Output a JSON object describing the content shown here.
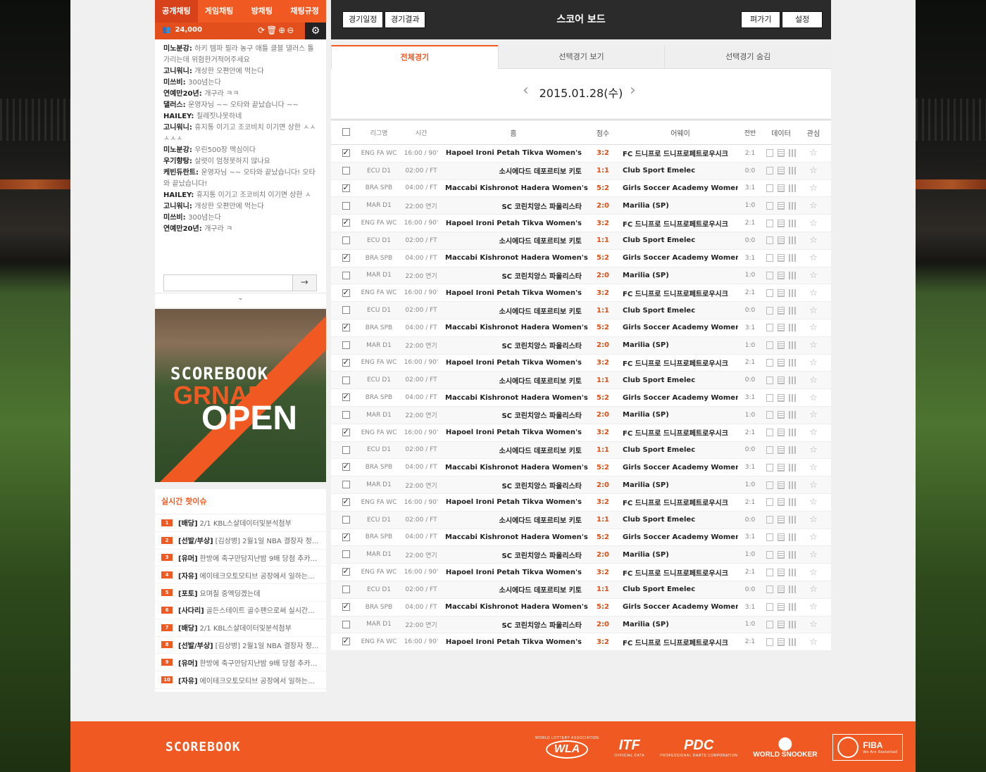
{
  "chat": {
    "tabs": [
      "공개채팅",
      "게임채팅",
      "방채팅",
      "채팅규정"
    ],
    "user_count": "24,000",
    "messages": [
      {
        "user": "미노분강",
        "text": "하키 템파 필라 농구 애틀 클블 댈러스 톨가리는데 위험한거적어주세요"
      },
      {
        "user": "고니워니",
        "text": "개상한 오편만에 먹는다"
      },
      {
        "user": "미쓰비",
        "text": "300넘는다"
      },
      {
        "user": "연예만20년",
        "text": "개구라 ㅋㅋ"
      },
      {
        "user": "댈러스",
        "text": "운영자님 ~~ 오타와 끝났습니다 ~~"
      },
      {
        "user": "HAILEY",
        "text": "칠레짓나못하네"
      },
      {
        "user": "고니워니",
        "text": "휴지통 이기고 조코비치 이기면 상한 ㅅㅅㅅㅅㅅ"
      },
      {
        "user": "미노분강",
        "text": "우린500장 맥심이다"
      },
      {
        "user": "우기향탕",
        "text": "살렷이 엄청못하지 않나요"
      },
      {
        "user": "케빈듀란트",
        "text": "운영자님 ~~ 오타와 끝났습니다! 오타와 끝났습니다!"
      },
      {
        "user": "HAILEY",
        "text": "휴지통 이기고 조코비치 이기면 상한 ㅅ"
      },
      {
        "user": "고니워니",
        "text": "개상한 오편만에 먹는다"
      },
      {
        "user": "미쓰비",
        "text": "300넘는다"
      },
      {
        "user": "연예만20년",
        "text": "개구라 ㅋ"
      }
    ],
    "input_value": ""
  },
  "banner": {
    "line1": "SCOREBOOK",
    "line2": "GRNAD",
    "line3": "OPEN"
  },
  "issues": {
    "title": "실시간 핫이슈",
    "items": [
      {
        "num": "1",
        "tag": "[배당]",
        "text": "2/1 KBL스샬데이터및분석첨부"
      },
      {
        "num": "2",
        "tag": "[선발/부상]",
        "text": "[김상병] 2월1일 NBA 결장자 정..."
      },
      {
        "num": "3",
        "tag": "[유머]",
        "text": "한방에 축구만담지난밤 9배 당첨 추카..."
      },
      {
        "num": "4",
        "tag": "[자유]",
        "text": "에이테크오토모티브 공장에서 일하는..."
      },
      {
        "num": "5",
        "tag": "[포토]",
        "text": "요며칠 중엑딩겠는데"
      },
      {
        "num": "6",
        "tag": "[사다리]",
        "text": "골든스테이트 골수팬으로써 실시간..."
      },
      {
        "num": "7",
        "tag": "[배당]",
        "text": "2/1 KBL스샬데이터및분석첨부"
      },
      {
        "num": "8",
        "tag": "[선발/부상]",
        "text": "[김상병] 2월1일 NBA 결장자 정..."
      },
      {
        "num": "9",
        "tag": "[유머]",
        "text": "한방에 축구만담지난밤 9배 당첨 추카..."
      },
      {
        "num": "10",
        "tag": "[자유]",
        "text": "에이테크오토모티브 공장에서 일하는..."
      }
    ]
  },
  "score": {
    "btn_schedule": "경기일정",
    "btn_results": "경기결과",
    "title": "스코어 보드",
    "btn_edit": "펴가기",
    "btn_settings": "설정",
    "tabs": [
      "전체경기",
      "선택경기 보기",
      "선택경기 숨김"
    ],
    "date": "2015.01.28(수)",
    "headers": {
      "league": "리그명",
      "time": "시간",
      "home": "홈",
      "score": "점수",
      "away": "어웨이",
      "half": "전반",
      "data": "데이터",
      "fav": "관심"
    },
    "rows": [
      {
        "checked": true,
        "league": "ENG FA WC",
        "time": "16:00 / 90'",
        "home": "Hapoel Ironi Petah Tikva Women's",
        "score": "3:2",
        "away": "FC 드니프로 드니프로페트로우시크",
        "half": "2:1"
      },
      {
        "checked": false,
        "league": "ECU D1",
        "time": "02:00 / FT",
        "home": "소시에다드 데포르티보 키토",
        "score": "1:1",
        "away": "Club Sport Emelec",
        "half": "0:0"
      },
      {
        "checked": true,
        "league": "BRA SPB",
        "time": "04:00 / FT",
        "home": "Maccabi Kishronot Hadera Women's",
        "score": "5:2",
        "away": "Girls Soccer Academy Women's",
        "half": "3:1"
      },
      {
        "checked": false,
        "league": "MAR D1",
        "time": "22:00 연기",
        "home": "SC 코린치앙스 파울리스타",
        "score": "2:0",
        "away": "Marilia (SP)",
        "half": "1:0"
      },
      {
        "checked": true,
        "league": "ENG FA WC",
        "time": "16:00 / 90'",
        "home": "Hapoel Ironi Petah Tikva Women's",
        "score": "3:2",
        "away": "FC 드니프로 드니프로페트로우시크",
        "half": "2:1"
      },
      {
        "checked": false,
        "league": "ECU D1",
        "time": "02:00 / FT",
        "home": "소시에다드 데포르티보 키토",
        "score": "1:1",
        "away": "Club Sport Emelec",
        "half": "0:0"
      },
      {
        "checked": true,
        "league": "BRA SPB",
        "time": "04:00 / FT",
        "home": "Maccabi Kishronot Hadera Women's",
        "score": "5:2",
        "away": "Girls Soccer Academy Women's",
        "half": "3:1"
      },
      {
        "checked": false,
        "league": "MAR D1",
        "time": "22:00 연기",
        "home": "SC 코린치앙스 파울리스타",
        "score": "2:0",
        "away": "Marilia (SP)",
        "half": "1:0"
      },
      {
        "checked": true,
        "league": "ENG FA WC",
        "time": "16:00 / 90'",
        "home": "Hapoel Ironi Petah Tikva Women's",
        "score": "3:2",
        "away": "FC 드니프로 드니프로페트로우시크",
        "half": "2:1"
      },
      {
        "checked": false,
        "league": "ECU D1",
        "time": "02:00 / FT",
        "home": "소시에다드 데포르티보 키토",
        "score": "1:1",
        "away": "Club Sport Emelec",
        "half": "0:0"
      },
      {
        "checked": true,
        "league": "BRA SPB",
        "time": "04:00 / FT",
        "home": "Maccabi Kishronot Hadera Women's",
        "score": "5:2",
        "away": "Girls Soccer Academy Women's",
        "half": "3:1"
      },
      {
        "checked": false,
        "league": "MAR D1",
        "time": "22:00 연기",
        "home": "SC 코린치앙스 파울리스타",
        "score": "2:0",
        "away": "Marilia (SP)",
        "half": "1:0"
      },
      {
        "checked": true,
        "league": "ENG FA WC",
        "time": "16:00 / 90'",
        "home": "Hapoel Ironi Petah Tikva Women's",
        "score": "3:2",
        "away": "FC 드니프로 드니프로페트로우시크",
        "half": "2:1"
      },
      {
        "checked": false,
        "league": "ECU D1",
        "time": "02:00 / FT",
        "home": "소시에다드 데포르티보 키토",
        "score": "1:1",
        "away": "Club Sport Emelec",
        "half": "0:0"
      },
      {
        "checked": true,
        "league": "BRA SPB",
        "time": "04:00 / FT",
        "home": "Maccabi Kishronot Hadera Women's",
        "score": "5:2",
        "away": "Girls Soccer Academy Women's",
        "half": "3:1"
      },
      {
        "checked": false,
        "league": "MAR D1",
        "time": "22:00 연기",
        "home": "SC 코린치앙스 파울리스타",
        "score": "2:0",
        "away": "Marilia (SP)",
        "half": "1:0"
      },
      {
        "checked": true,
        "league": "ENG FA WC",
        "time": "16:00 / 90'",
        "home": "Hapoel Ironi Petah Tikva Women's",
        "score": "3:2",
        "away": "FC 드니프로 드니프로페트로우시크",
        "half": "2:1"
      },
      {
        "checked": false,
        "league": "ECU D1",
        "time": "02:00 / FT",
        "home": "소시에다드 데포르티보 키토",
        "score": "1:1",
        "away": "Club Sport Emelec",
        "half": "0:0"
      },
      {
        "checked": true,
        "league": "BRA SPB",
        "time": "04:00 / FT",
        "home": "Maccabi Kishronot Hadera Women's",
        "score": "5:2",
        "away": "Girls Soccer Academy Women's",
        "half": "3:1"
      },
      {
        "checked": false,
        "league": "MAR D1",
        "time": "22:00 연기",
        "home": "SC 코린치앙스 파울리스타",
        "score": "2:0",
        "away": "Marilia (SP)",
        "half": "1:0"
      },
      {
        "checked": true,
        "league": "ENG FA WC",
        "time": "16:00 / 90'",
        "home": "Hapoel Ironi Petah Tikva Women's",
        "score": "3:2",
        "away": "FC 드니프로 드니프로페트로우시크",
        "half": "2:1"
      },
      {
        "checked": false,
        "league": "ECU D1",
        "time": "02:00 / FT",
        "home": "소시에다드 데포르티보 키토",
        "score": "1:1",
        "away": "Club Sport Emelec",
        "half": "0:0"
      },
      {
        "checked": true,
        "league": "BRA SPB",
        "time": "04:00 / FT",
        "home": "Maccabi Kishronot Hadera Women's",
        "score": "5:2",
        "away": "Girls Soccer Academy Women's",
        "half": "3:1"
      },
      {
        "checked": false,
        "league": "MAR D1",
        "time": "22:00 연기",
        "home": "SC 코린치앙스 파울리스타",
        "score": "2:0",
        "away": "Marilia (SP)",
        "half": "1:0"
      },
      {
        "checked": true,
        "league": "ENG FA WC",
        "time": "16:00 / 90'",
        "home": "Hapoel Ironi Petah Tikva Women's",
        "score": "3:2",
        "away": "FC 드니프로 드니프로페트로우시크",
        "half": "2:1"
      },
      {
        "checked": false,
        "league": "ECU D1",
        "time": "02:00 / FT",
        "home": "소시에다드 데포르티보 키토",
        "score": "1:1",
        "away": "Club Sport Emelec",
        "half": "0:0"
      },
      {
        "checked": true,
        "league": "BRA SPB",
        "time": "04:00 / FT",
        "home": "Maccabi Kishronot Hadera Women's",
        "score": "5:2",
        "away": "Girls Soccer Academy Women's",
        "half": "3:1"
      },
      {
        "checked": false,
        "league": "MAR D1",
        "time": "22:00 연기",
        "home": "SC 코린치앙스 파울리스타",
        "score": "2:0",
        "away": "Marilia (SP)",
        "half": "1:0"
      },
      {
        "checked": true,
        "league": "ENG FA WC",
        "time": "16:00 / 90'",
        "home": "Hapoel Ironi Petah Tikva Women's",
        "score": "3:2",
        "away": "FC 드니프로 드니프로페트로우시크",
        "half": "2:1"
      }
    ]
  },
  "footer": {
    "logo": "SCOREBOOK",
    "partners": [
      {
        "name": "WLA",
        "sub": "WORLD LOTTERY ASSOCIATION"
      },
      {
        "name": "ITF",
        "sub": "OFFICIAL DATA"
      },
      {
        "name": "PDC",
        "sub": "PROFESSIONAL DARTS CORPORATION"
      },
      {
        "name": "WORLD SNOOKER",
        "sub": ""
      },
      {
        "name": "FIBA",
        "sub": "We Are Basketball"
      }
    ]
  },
  "colors": {
    "accent": "#f05a22",
    "dark": "#2b2b2b",
    "score": "#e14d12"
  }
}
